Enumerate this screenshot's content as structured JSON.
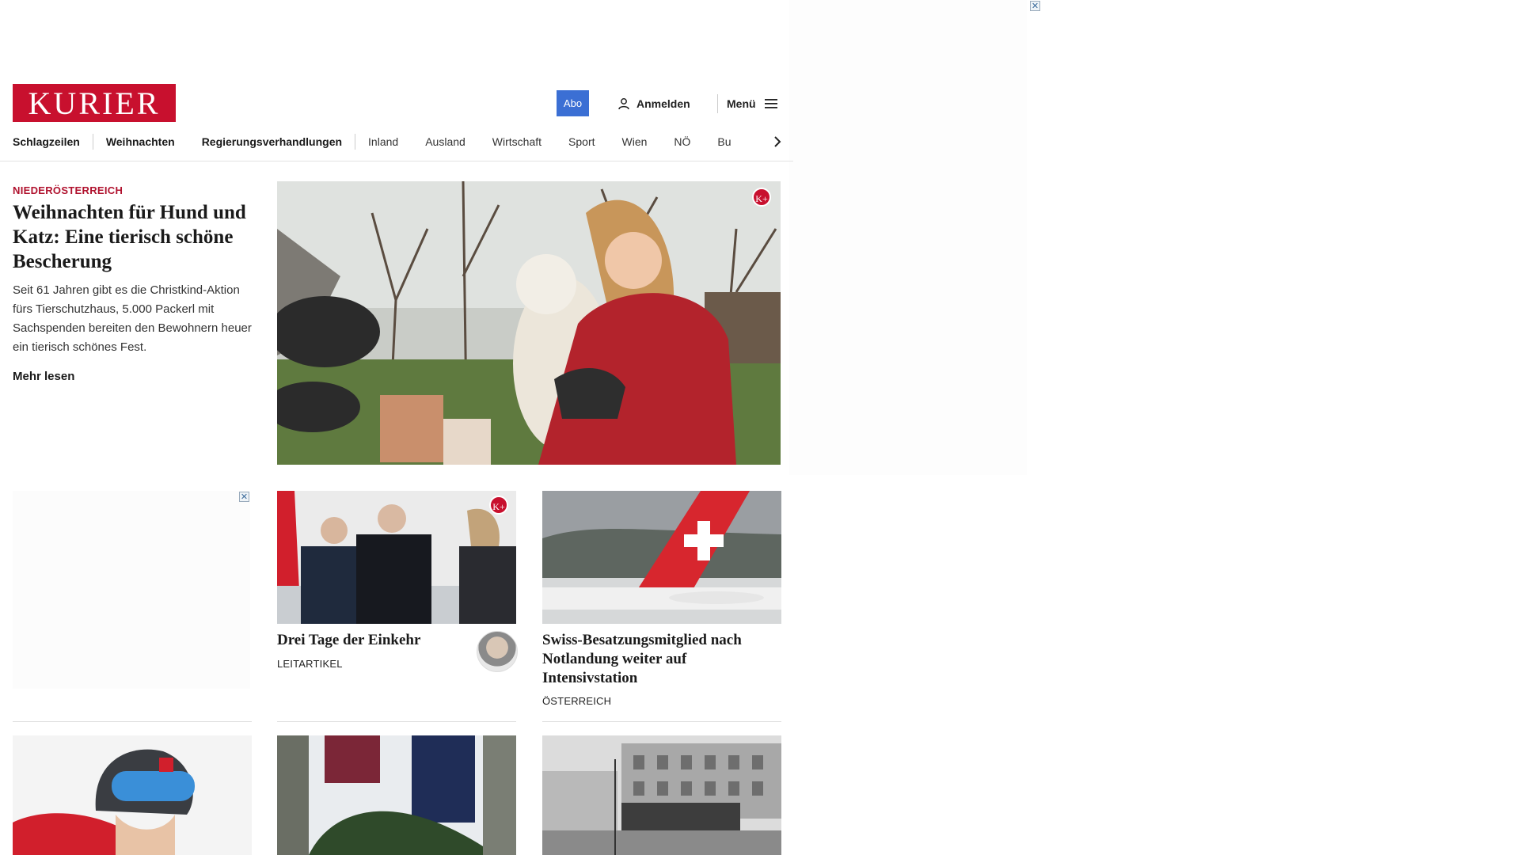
{
  "brand": {
    "name": "KURIER"
  },
  "header": {
    "abo_label": "Abo",
    "login_label": "Anmelden",
    "menu_label": "Menü"
  },
  "nav": {
    "items": [
      {
        "label": "Schlagzeilen",
        "bold": true
      },
      {
        "label": "Weihnachten",
        "bold": true
      },
      {
        "label": "Regierungsverhandlungen",
        "bold": true
      },
      {
        "label": "Inland",
        "bold": false
      },
      {
        "label": "Ausland",
        "bold": false
      },
      {
        "label": "Wirtschaft",
        "bold": false
      },
      {
        "label": "Sport",
        "bold": false
      },
      {
        "label": "Wien",
        "bold": false
      },
      {
        "label": "NÖ",
        "bold": false
      },
      {
        "label": "Bu",
        "bold": false
      }
    ]
  },
  "ad": {
    "close_symbol": "✕"
  },
  "lead": {
    "section": "NIEDERÖSTERREICH",
    "headline": "Weihnachten für Hund und Katz: Eine tierisch schöne Bescherung",
    "teaser": "Seit 61 Jahren gibt es die Christkind-Aktion fürs Tierschutzhaus, 5.000 Packerl mit Sachspenden bereiten den Bewohnern heuer ein tierisch schönes Fest.",
    "more": "Mehr lesen",
    "badge": "K+"
  },
  "articles": [
    {
      "headline": "Drei Tage der Einkehr",
      "label": "LEITARTIKEL",
      "badge": "K+"
    },
    {
      "headline": "Swiss-Besatzungsmitglied nach Notlandung weiter auf Intensivstation",
      "label": "ÖSTERREICH"
    }
  ],
  "colors": {
    "brand_red": "#c8102e",
    "abo_blue": "#3b6fd4",
    "section_red": "#b0122e"
  },
  "icons": {
    "login": "user-icon",
    "menu": "hamburger-icon",
    "nav_next": "chevron-right-icon",
    "ad_close": "close-icon"
  }
}
